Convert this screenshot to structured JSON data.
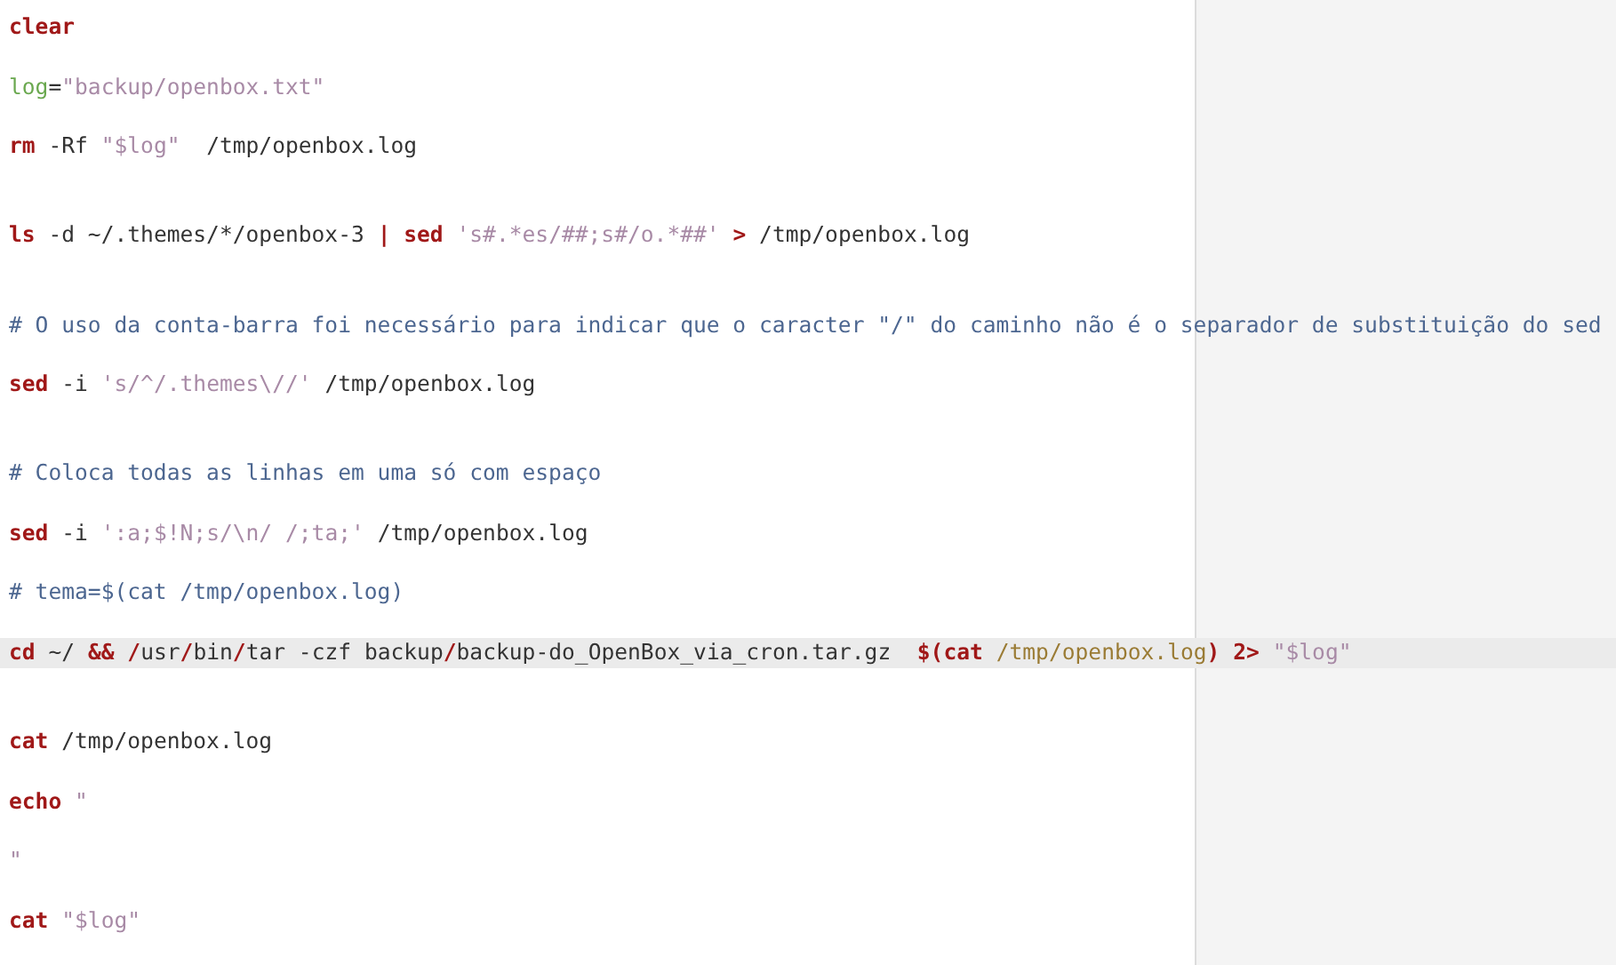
{
  "editor": {
    "lines": [
      {
        "kind": "code",
        "current": false,
        "tokens": [
          {
            "kind": "keyword",
            "text": "clear"
          }
        ]
      },
      {
        "kind": "blank"
      },
      {
        "kind": "code",
        "current": false,
        "tokens": [
          {
            "kind": "variable",
            "text": "log"
          },
          {
            "kind": "plain",
            "text": "="
          },
          {
            "kind": "string",
            "text": "\"backup/openbox.txt\""
          }
        ]
      },
      {
        "kind": "blank"
      },
      {
        "kind": "code",
        "current": false,
        "tokens": [
          {
            "kind": "keyword",
            "text": "rm"
          },
          {
            "kind": "plain",
            "text": " -Rf "
          },
          {
            "kind": "string",
            "text": "\"$log\""
          },
          {
            "kind": "plain",
            "text": "  /tmp/openbox.log"
          }
        ]
      },
      {
        "kind": "blank"
      },
      {
        "kind": "blank"
      },
      {
        "kind": "code",
        "current": false,
        "tokens": [
          {
            "kind": "keyword",
            "text": "ls"
          },
          {
            "kind": "plain",
            "text": " -d ~/.themes/*/openbox-3 "
          },
          {
            "kind": "keyword",
            "text": "|"
          },
          {
            "kind": "keyword",
            "text": " sed"
          },
          {
            "kind": "string",
            "text": " 's#.*es/##;s#/o.*##'"
          },
          {
            "kind": "keyword",
            "text": " >"
          },
          {
            "kind": "plain",
            "text": " /tmp/openbox.log"
          }
        ]
      },
      {
        "kind": "blank"
      },
      {
        "kind": "blank"
      },
      {
        "kind": "code",
        "current": false,
        "tokens": [
          {
            "kind": "comment",
            "text": "# O uso da conta-barra foi necessário para indicar que o caracter \"/\" do caminho não é o separador de substituição do sed"
          }
        ]
      },
      {
        "kind": "blank"
      },
      {
        "kind": "code",
        "current": false,
        "tokens": [
          {
            "kind": "keyword",
            "text": "sed"
          },
          {
            "kind": "plain",
            "text": " -i "
          },
          {
            "kind": "string",
            "text": "'s/^/.themes\\//'"
          },
          {
            "kind": "plain",
            "text": " /tmp/openbox.log"
          }
        ]
      },
      {
        "kind": "blank"
      },
      {
        "kind": "blank"
      },
      {
        "kind": "code",
        "current": false,
        "tokens": [
          {
            "kind": "comment",
            "text": "# Coloca todas as linhas em uma só com espaço"
          }
        ]
      },
      {
        "kind": "blank"
      },
      {
        "kind": "code",
        "current": false,
        "tokens": [
          {
            "kind": "keyword",
            "text": "sed"
          },
          {
            "kind": "plain",
            "text": " -i "
          },
          {
            "kind": "string",
            "text": "':a;$!N;s/\\n/ /;ta;'"
          },
          {
            "kind": "plain",
            "text": " /tmp/openbox.log"
          }
        ]
      },
      {
        "kind": "blank"
      },
      {
        "kind": "code",
        "current": false,
        "tokens": [
          {
            "kind": "comment",
            "text": "# tema=$(cat /tmp/openbox.log)"
          }
        ]
      },
      {
        "kind": "blank"
      },
      {
        "kind": "code",
        "current": true,
        "tokens": [
          {
            "kind": "keyword",
            "text": "cd"
          },
          {
            "kind": "plain",
            "text": " ~/ "
          },
          {
            "kind": "keyword",
            "text": "&&"
          },
          {
            "kind": "keyword",
            "text": " /"
          },
          {
            "kind": "plain",
            "text": "usr"
          },
          {
            "kind": "keyword",
            "text": "/"
          },
          {
            "kind": "plain",
            "text": "bin"
          },
          {
            "kind": "keyword",
            "text": "/"
          },
          {
            "kind": "plain",
            "text": "tar -czf backup"
          },
          {
            "kind": "keyword",
            "text": "/"
          },
          {
            "kind": "plain",
            "text": "backup-do_OpenBox_via_cron.tar.gz  "
          },
          {
            "kind": "keyword",
            "text": "$(cat"
          },
          {
            "kind": "path",
            "text": " /tmp/openbox.log"
          },
          {
            "kind": "keyword",
            "text": ")"
          },
          {
            "kind": "keyword",
            "text": " 2>"
          },
          {
            "kind": "string",
            "text": " \"$log\""
          }
        ]
      },
      {
        "kind": "blank"
      },
      {
        "kind": "blank"
      },
      {
        "kind": "code",
        "current": false,
        "tokens": [
          {
            "kind": "keyword",
            "text": "cat"
          },
          {
            "kind": "plain",
            "text": " /tmp/openbox.log"
          }
        ]
      },
      {
        "kind": "blank"
      },
      {
        "kind": "code",
        "current": false,
        "tokens": [
          {
            "kind": "keyword",
            "text": "echo"
          },
          {
            "kind": "string",
            "text": " \""
          }
        ]
      },
      {
        "kind": "blank"
      },
      {
        "kind": "code",
        "current": false,
        "tokens": [
          {
            "kind": "string",
            "text": "\""
          }
        ]
      },
      {
        "kind": "blank"
      },
      {
        "kind": "code",
        "current": false,
        "tokens": [
          {
            "kind": "keyword",
            "text": "cat"
          },
          {
            "kind": "string",
            "text": " \"$log\""
          }
        ]
      }
    ]
  }
}
